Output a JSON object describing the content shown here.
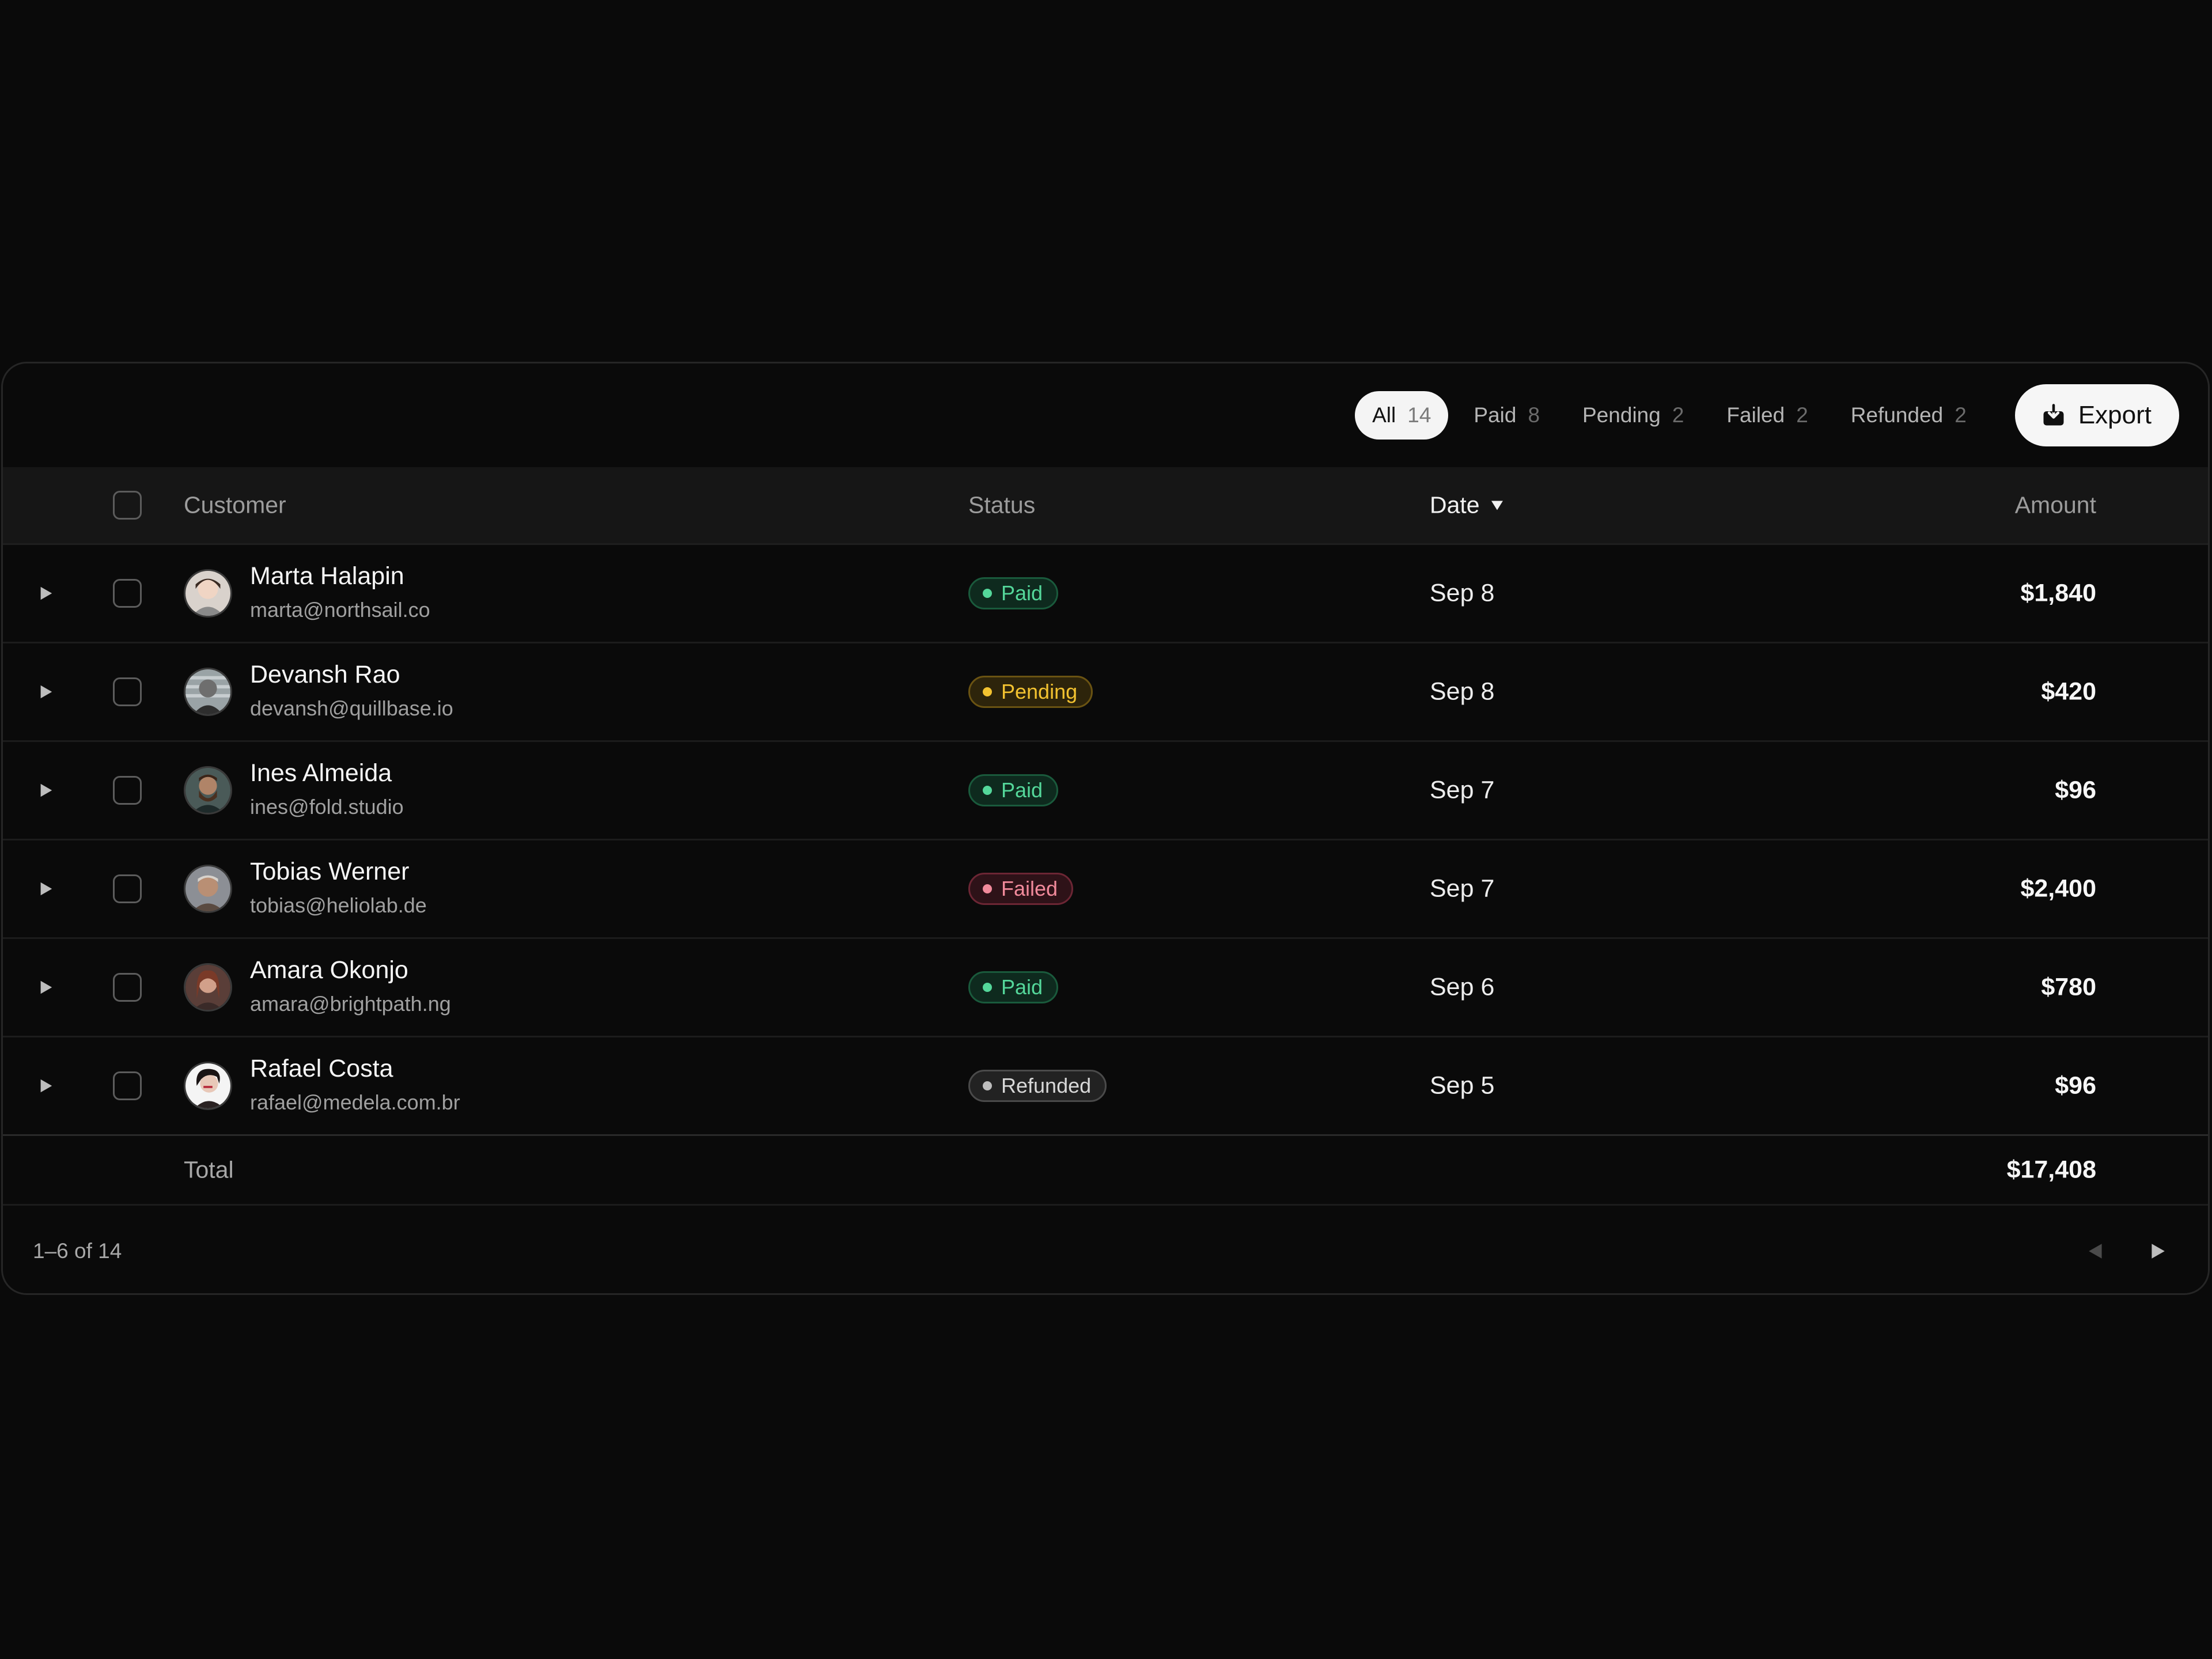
{
  "filters": [
    {
      "label": "All",
      "count": "14",
      "active": true
    },
    {
      "label": "Paid",
      "count": "8",
      "active": false
    },
    {
      "label": "Pending",
      "count": "2",
      "active": false
    },
    {
      "label": "Failed",
      "count": "2",
      "active": false
    },
    {
      "label": "Refunded",
      "count": "2",
      "active": false
    }
  ],
  "toolbar": {
    "export_label": "Export"
  },
  "columns": {
    "customer": "Customer",
    "status": "Status",
    "date": "Date",
    "amount": "Amount"
  },
  "rows": [
    {
      "name": "Marta Halapin",
      "email": "marta@northsail.co",
      "status": "Paid",
      "status_key": "paid",
      "date": "Sep 8",
      "amount": "$1,840"
    },
    {
      "name": "Devansh Rao",
      "email": "devansh@quillbase.io",
      "status": "Pending",
      "status_key": "pending",
      "date": "Sep 8",
      "amount": "$420"
    },
    {
      "name": "Ines Almeida",
      "email": "ines@fold.studio",
      "status": "Paid",
      "status_key": "paid",
      "date": "Sep 7",
      "amount": "$96"
    },
    {
      "name": "Tobias Werner",
      "email": "tobias@heliolab.de",
      "status": "Failed",
      "status_key": "failed",
      "date": "Sep 7",
      "amount": "$2,400"
    },
    {
      "name": "Amara Okonjo",
      "email": "amara@brightpath.ng",
      "status": "Paid",
      "status_key": "paid",
      "date": "Sep 6",
      "amount": "$780"
    },
    {
      "name": "Rafael Costa",
      "email": "rafael@medela.com.br",
      "status": "Refunded",
      "status_key": "refunded",
      "date": "Sep 5",
      "amount": "$96"
    }
  ],
  "total": {
    "label": "Total",
    "value": "$17,408"
  },
  "pagination": {
    "range": "1–6 of 14"
  },
  "colors": {
    "background": "#0a0a0a",
    "paid": "#54d79a",
    "pending": "#f2c230",
    "failed": "#f18a9b",
    "refunded": "#bdbdbd"
  }
}
